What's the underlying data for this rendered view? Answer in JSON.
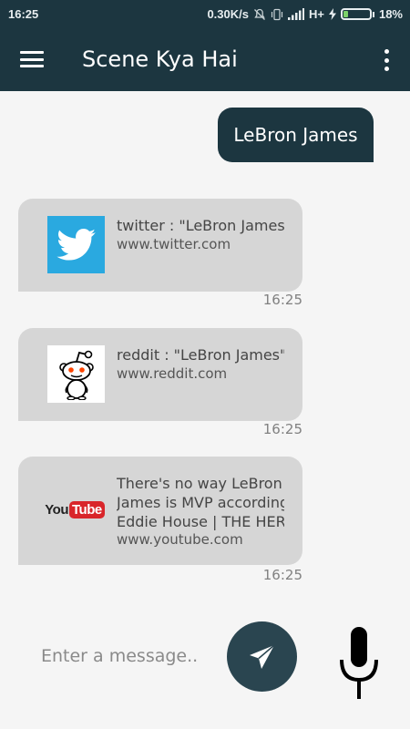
{
  "status_bar": {
    "time": "16:25",
    "network_speed": "0.30K/s",
    "network_type": "H+",
    "battery_percent": "18%",
    "battery_level": 0.18,
    "icons": [
      "mute-icon",
      "vibrate-icon",
      "signal-icon",
      "charging-icon",
      "battery-icon"
    ]
  },
  "app_bar": {
    "title": "Scene Kya Hai",
    "menu_icon": "hamburger-menu-icon",
    "overflow_icon": "more-vert-icon"
  },
  "chat": {
    "user_message": "LeBron James",
    "results": [
      {
        "source": "twitter",
        "title": "twitter : \"LeBron James\"",
        "url": "www.twitter.com",
        "time": "16:25",
        "icon": "twitter-logo"
      },
      {
        "source": "reddit",
        "title": "reddit : \"LeBron James\"",
        "url": "www.reddit.com",
        "time": "16:25",
        "icon": "reddit-logo"
      },
      {
        "source": "youtube",
        "title_lines": [
          "There's no way LeBron",
          "James is MVP according",
          "Eddie House | THE HERD"
        ],
        "url": "www.youtube.com",
        "time": "16:25",
        "icon": "youtube-logo",
        "logo_text_left": "You",
        "logo_text_right": "Tube"
      }
    ]
  },
  "input": {
    "placeholder": "Enter a message..",
    "value": "",
    "send_icon": "send-icon",
    "mic_icon": "microphone-icon"
  },
  "colors": {
    "primary_dark": "#1c3640",
    "send_button": "#2a4550",
    "card_bg": "#d6d6d6",
    "background": "#f5f5f5",
    "twitter_blue": "#2aa9e0",
    "youtube_red": "#d9252a"
  }
}
